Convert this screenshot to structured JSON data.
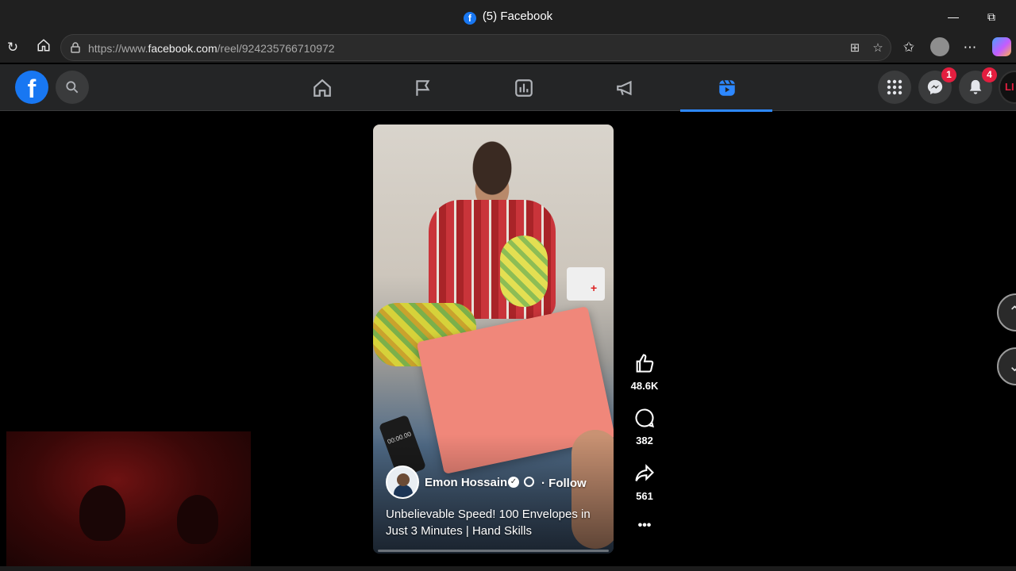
{
  "window": {
    "title": "(5) Facebook",
    "favicon_letter": "f"
  },
  "browser": {
    "url_prefix": "https://www.",
    "url_domain": "facebook.com",
    "url_path": "/reel/924235766710972"
  },
  "fb_nav": {
    "logo_letter": "f",
    "tabs": [
      "home",
      "pages",
      "insights",
      "ads",
      "reels"
    ],
    "active_tab": "reels",
    "messenger_badge": "1",
    "notifications_badge": "4",
    "profile_partial_text": "LI"
  },
  "reel": {
    "author": "Emon Hossain",
    "follow_label": "· Follow",
    "caption": "Unbelievable Speed! 100 Envelopes in Just 3 Minutes | Hand Skills",
    "stopwatch_text": "00:00.00",
    "likes": "48.6K",
    "comments": "382",
    "shares": "561",
    "more_label": "•••"
  },
  "colors": {
    "accent": "#2d88ff",
    "badge": "#e41e3f",
    "fb_blue": "#1877f2"
  }
}
